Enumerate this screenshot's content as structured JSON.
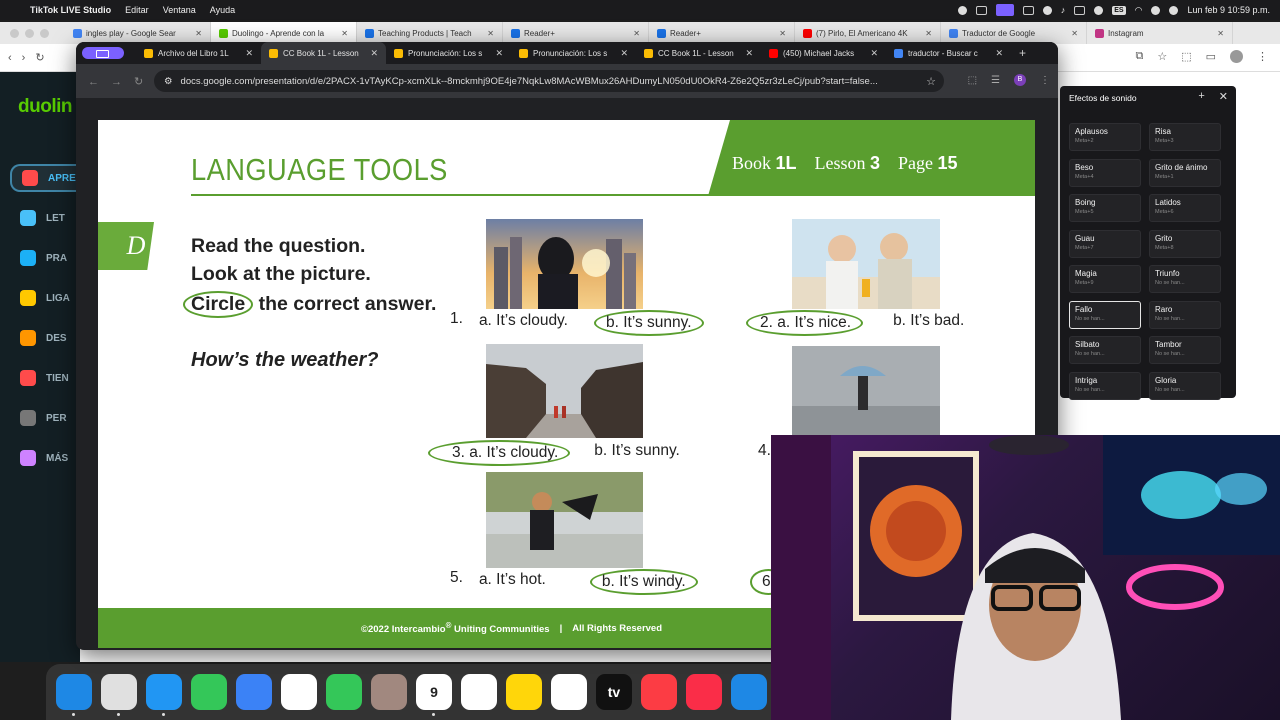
{
  "menubar": {
    "app": "TikTok LIVE Studio",
    "items": [
      "Editar",
      "Ventana",
      "Ayuda"
    ],
    "lang": "ES",
    "clock": "Lun feb 9  10:59 p.m."
  },
  "bg_window": {
    "tabs": [
      {
        "title": "ingles play - Google Sear",
        "color": "#4285f4"
      },
      {
        "title": "Duolingo - Aprende con la",
        "color": "#58cc02",
        "active": true
      },
      {
        "title": "Teaching Products | Teach",
        "color": "#1a73e8"
      },
      {
        "title": "Reader+",
        "color": "#1a73e8"
      },
      {
        "title": "Reader+",
        "color": "#1a73e8"
      },
      {
        "title": "(7) Pirlo, El Americano 4K",
        "color": "#ff0000"
      },
      {
        "title": "Traductor de Google",
        "color": "#4285f4"
      },
      {
        "title": "Instagram",
        "color": "#c13584"
      }
    ]
  },
  "duolingo": {
    "logo": "duolin",
    "nav": [
      {
        "label": "APRE",
        "color": "#ff4b4b",
        "active": true
      },
      {
        "label": "LET",
        "color": "#49c0f8"
      },
      {
        "label": "PRA",
        "color": "#1cb0f6"
      },
      {
        "label": "LIGA",
        "color": "#ffc800"
      },
      {
        "label": "DES",
        "color": "#ff9600"
      },
      {
        "label": "TIEN",
        "color": "#ff4b4b"
      },
      {
        "label": "PER",
        "color": "#777777"
      },
      {
        "label": "MÁS",
        "color": "#ce82ff"
      }
    ]
  },
  "fg_window": {
    "tabs": [
      {
        "title": "Archivo del Libro 1L",
        "color": "#fbbc04"
      },
      {
        "title": "CC Book 1L - Lesson",
        "color": "#fbbc04",
        "active": true
      },
      {
        "title": "Pronunciación: Los s",
        "color": "#fbbc04"
      },
      {
        "title": "Pronunciación: Los s",
        "color": "#fbbc04"
      },
      {
        "title": "CC Book 1L - Lesson",
        "color": "#fbbc04"
      },
      {
        "title": "(450) Michael Jacks",
        "color": "#ff0000"
      },
      {
        "title": "traductor - Buscar c",
        "color": "#4285f4"
      }
    ],
    "url": "docs.google.com/presentation/d/e/2PACX-1vTAyKCp-xcmXLk--8mckmhj9OE4je7NqkLw8MAcWBMux26AHDumyLN050dU0OkR4-Z6e2Q5zr3zLeCj/pub?start=false..."
  },
  "slide": {
    "title": "LANGUAGE TOOLS",
    "book_label": "Book",
    "book": "1L",
    "lesson_label": "Lesson",
    "lesson": "3",
    "page_label": "Page",
    "page": "15",
    "section": "D",
    "instructions": [
      "Read the question.",
      "Look at the picture.",
      "Circle",
      " the correct answer."
    ],
    "question": "How’s the weather?",
    "answers": [
      {
        "num": "1.",
        "a": "a. It’s cloudy.",
        "b": "b.  It’s sunny.",
        "circled": "b"
      },
      {
        "num": "2.",
        "a": "a. It’s nice.",
        "b": "b.  It’s bad.",
        "circled": "a"
      },
      {
        "num": "3.",
        "a": "a. It’s cloudy.",
        "b": "b.  It’s sunny.",
        "circled": "a"
      },
      {
        "num": "4.",
        "a": "",
        "b": ""
      },
      {
        "num": "5.",
        "a": "a. It’s hot.",
        "b": "b.  It’s windy.",
        "circled": "b"
      },
      {
        "num": "6.",
        "a": "",
        "b": ""
      }
    ],
    "footer": "©2022 Intercambio",
    "footer_sup": "®",
    "footer_mid": " Uniting Communities",
    "footer_sep": "|",
    "footer_rights": "All Rights Reserved"
  },
  "sound_effects": {
    "title": "Efectos de sonido",
    "buttons": [
      {
        "name": "Aplausos",
        "key": "Meta+2"
      },
      {
        "name": "Risa",
        "key": "Meta+3"
      },
      {
        "name": "Beso",
        "key": "Meta+4"
      },
      {
        "name": "Grito de ánimo",
        "key": "Meta+1"
      },
      {
        "name": "Boing",
        "key": "Meta+5"
      },
      {
        "name": "Latidos",
        "key": "Meta+6"
      },
      {
        "name": "Guau",
        "key": "Meta+7"
      },
      {
        "name": "Grito",
        "key": "Meta+8"
      },
      {
        "name": "Magia",
        "key": "Meta+9"
      },
      {
        "name": "Triunfo",
        "key": "No se han..."
      },
      {
        "name": "Fallo",
        "key": "No se han...",
        "selected": true
      },
      {
        "name": "Raro",
        "key": "No se han..."
      },
      {
        "name": "Silbato",
        "key": "No se han..."
      },
      {
        "name": "Tambor",
        "key": "No se han..."
      },
      {
        "name": "Intriga",
        "key": "No se han..."
      },
      {
        "name": "Gloria",
        "key": "No se han..."
      }
    ]
  },
  "dock": [
    {
      "name": "finder",
      "color": "#1e88e5"
    },
    {
      "name": "launchpad",
      "color": "#e0e0e0"
    },
    {
      "name": "safari",
      "color": "#2196f3"
    },
    {
      "name": "messages",
      "color": "#34c759"
    },
    {
      "name": "mail",
      "color": "#3b82f6"
    },
    {
      "name": "photos",
      "color": "#ffffff"
    },
    {
      "name": "facetime",
      "color": "#34c759"
    },
    {
      "name": "contacts",
      "color": "#a1887f"
    },
    {
      "name": "calendar",
      "color": "#ffffff",
      "text": "9",
      "sub": "LUN"
    },
    {
      "name": "reminders",
      "color": "#ffffff"
    },
    {
      "name": "notes",
      "color": "#ffd60a"
    },
    {
      "name": "freeform",
      "color": "#ffffff"
    },
    {
      "name": "tv",
      "color": "#111111",
      "text": "tv"
    },
    {
      "name": "music",
      "color": "#fc3c44"
    },
    {
      "name": "news",
      "color": "#fa2d48"
    },
    {
      "name": "app-store",
      "color": "#1e88e5"
    }
  ]
}
